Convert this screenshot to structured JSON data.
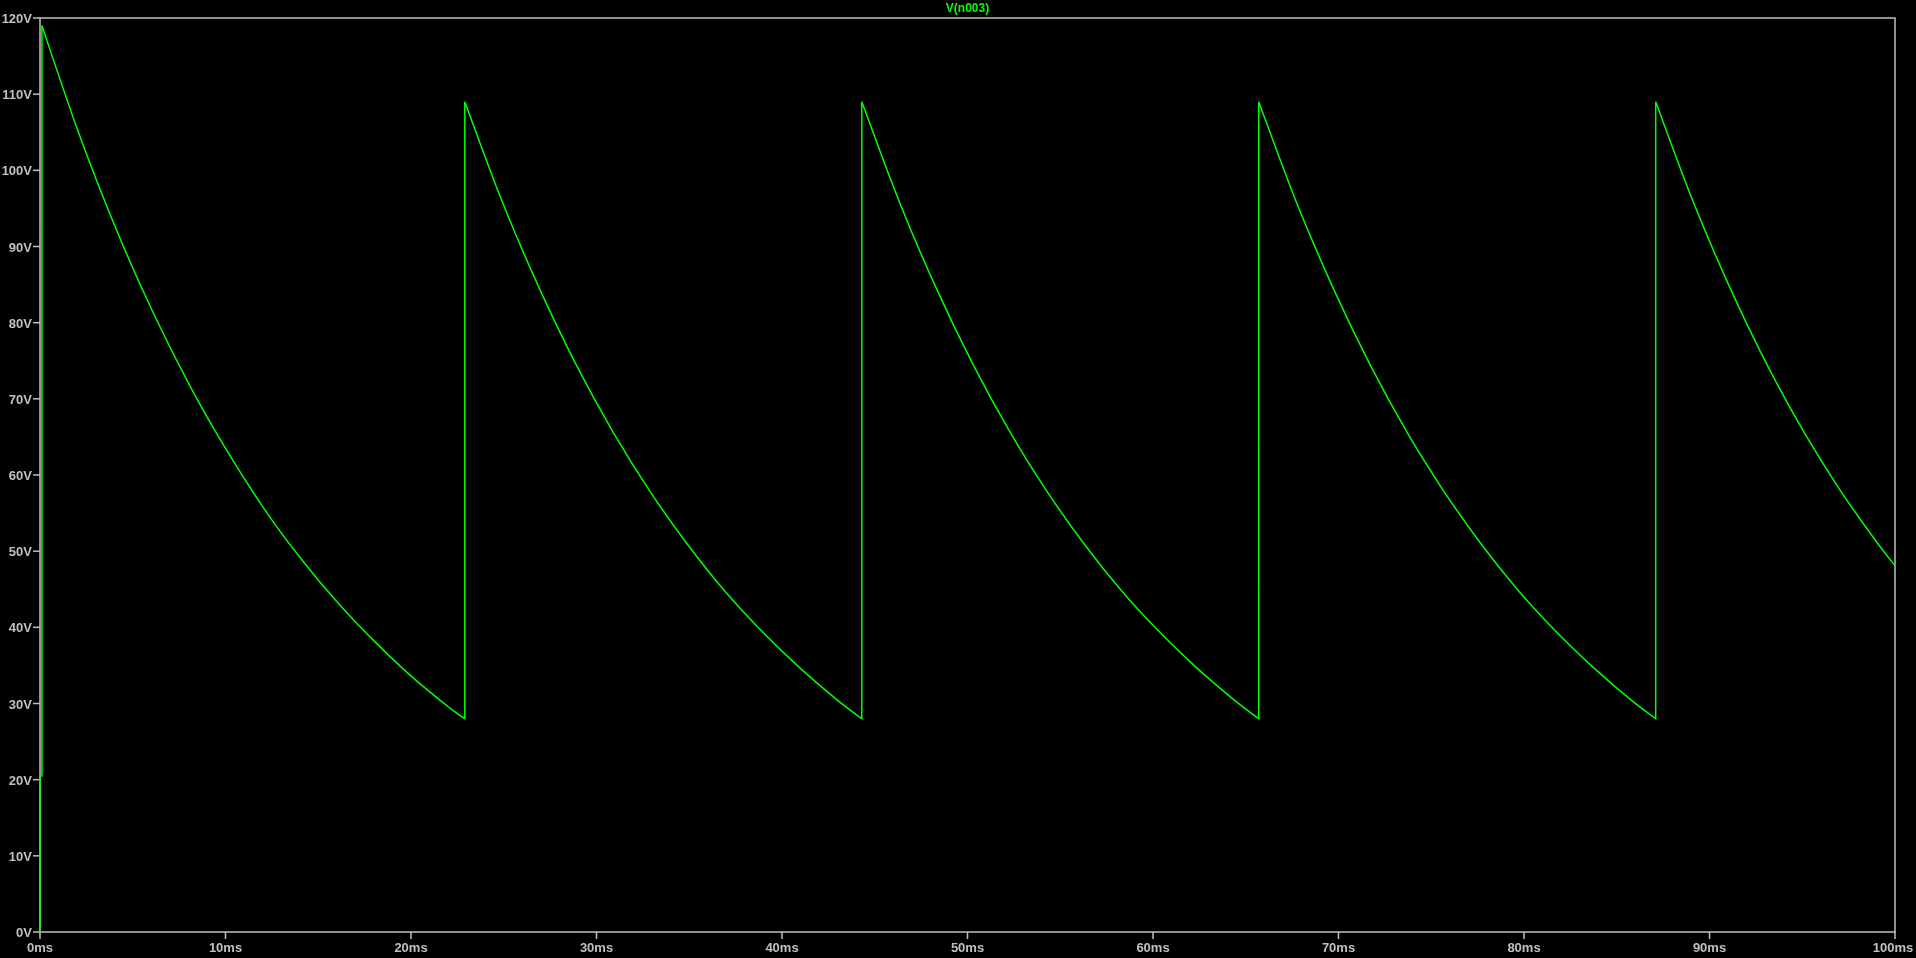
{
  "chart_data": {
    "type": "line",
    "xlim": [
      0,
      100
    ],
    "ylim": [
      0,
      120
    ],
    "xticks": [
      {
        "value": 0,
        "label": "0ms"
      },
      {
        "value": 10,
        "label": "10ms"
      },
      {
        "value": 20,
        "label": "20ms"
      },
      {
        "value": 30,
        "label": "30ms"
      },
      {
        "value": 40,
        "label": "40ms"
      },
      {
        "value": 50,
        "label": "50ms"
      },
      {
        "value": 60,
        "label": "60ms"
      },
      {
        "value": 70,
        "label": "70ms"
      },
      {
        "value": 80,
        "label": "80ms"
      },
      {
        "value": 90,
        "label": "90ms"
      },
      {
        "value": 100,
        "label": "100ms"
      }
    ],
    "yticks": [
      {
        "value": 0,
        "label": "0V"
      },
      {
        "value": 10,
        "label": "10V"
      },
      {
        "value": 20,
        "label": "20V"
      },
      {
        "value": 30,
        "label": "30V"
      },
      {
        "value": 40,
        "label": "40V"
      },
      {
        "value": 50,
        "label": "50V"
      },
      {
        "value": 60,
        "label": "60V"
      },
      {
        "value": 70,
        "label": "70V"
      },
      {
        "value": 80,
        "label": "80V"
      },
      {
        "value": 90,
        "label": "90V"
      },
      {
        "value": 100,
        "label": "100V"
      },
      {
        "value": 110,
        "label": "110V"
      },
      {
        "value": 120,
        "label": "120V"
      }
    ],
    "x": [
      0,
      0,
      0.1,
      0.1,
      2.1,
      4.1,
      6.1,
      8.1,
      10.1,
      12.1,
      14.1,
      16.1,
      18.1,
      20.1,
      22.1,
      22.9,
      22.9,
      24.9,
      26.9,
      28.9,
      30.9,
      32.9,
      34.9,
      36.9,
      38.9,
      40.9,
      42.9,
      44.3,
      44.3,
      46.3,
      48.3,
      50.3,
      52.3,
      54.3,
      56.3,
      58.3,
      60.3,
      62.3,
      64.3,
      65.7,
      65.7,
      67.7,
      69.7,
      71.7,
      73.7,
      75.7,
      77.7,
      79.7,
      81.7,
      83.7,
      85.7,
      87.1,
      87.1,
      89.1,
      91.1,
      93.1,
      95.1,
      97.1,
      99.1,
      100
    ],
    "series": [
      {
        "name": "V(n003)",
        "color": "#00ff00",
        "values": [
          0,
          20.5,
          20.5,
          119,
          104.8,
          92.3,
          81.3,
          71.6,
          63.1,
          55.5,
          48.9,
          43.1,
          38.0,
          33.4,
          29.4,
          28.0,
          109,
          96.0,
          84.6,
          74.5,
          65.6,
          57.8,
          50.9,
          44.8,
          39.5,
          34.8,
          30.6,
          28.0,
          109,
          96.0,
          84.6,
          74.5,
          65.6,
          57.8,
          50.9,
          44.8,
          39.5,
          34.8,
          30.6,
          28.0,
          109,
          96.0,
          84.6,
          74.5,
          65.6,
          57.8,
          50.9,
          44.8,
          39.5,
          34.8,
          30.6,
          28.0,
          109,
          96.0,
          84.6,
          74.5,
          65.6,
          57.8,
          50.9,
          48.1
        ]
      }
    ]
  }
}
